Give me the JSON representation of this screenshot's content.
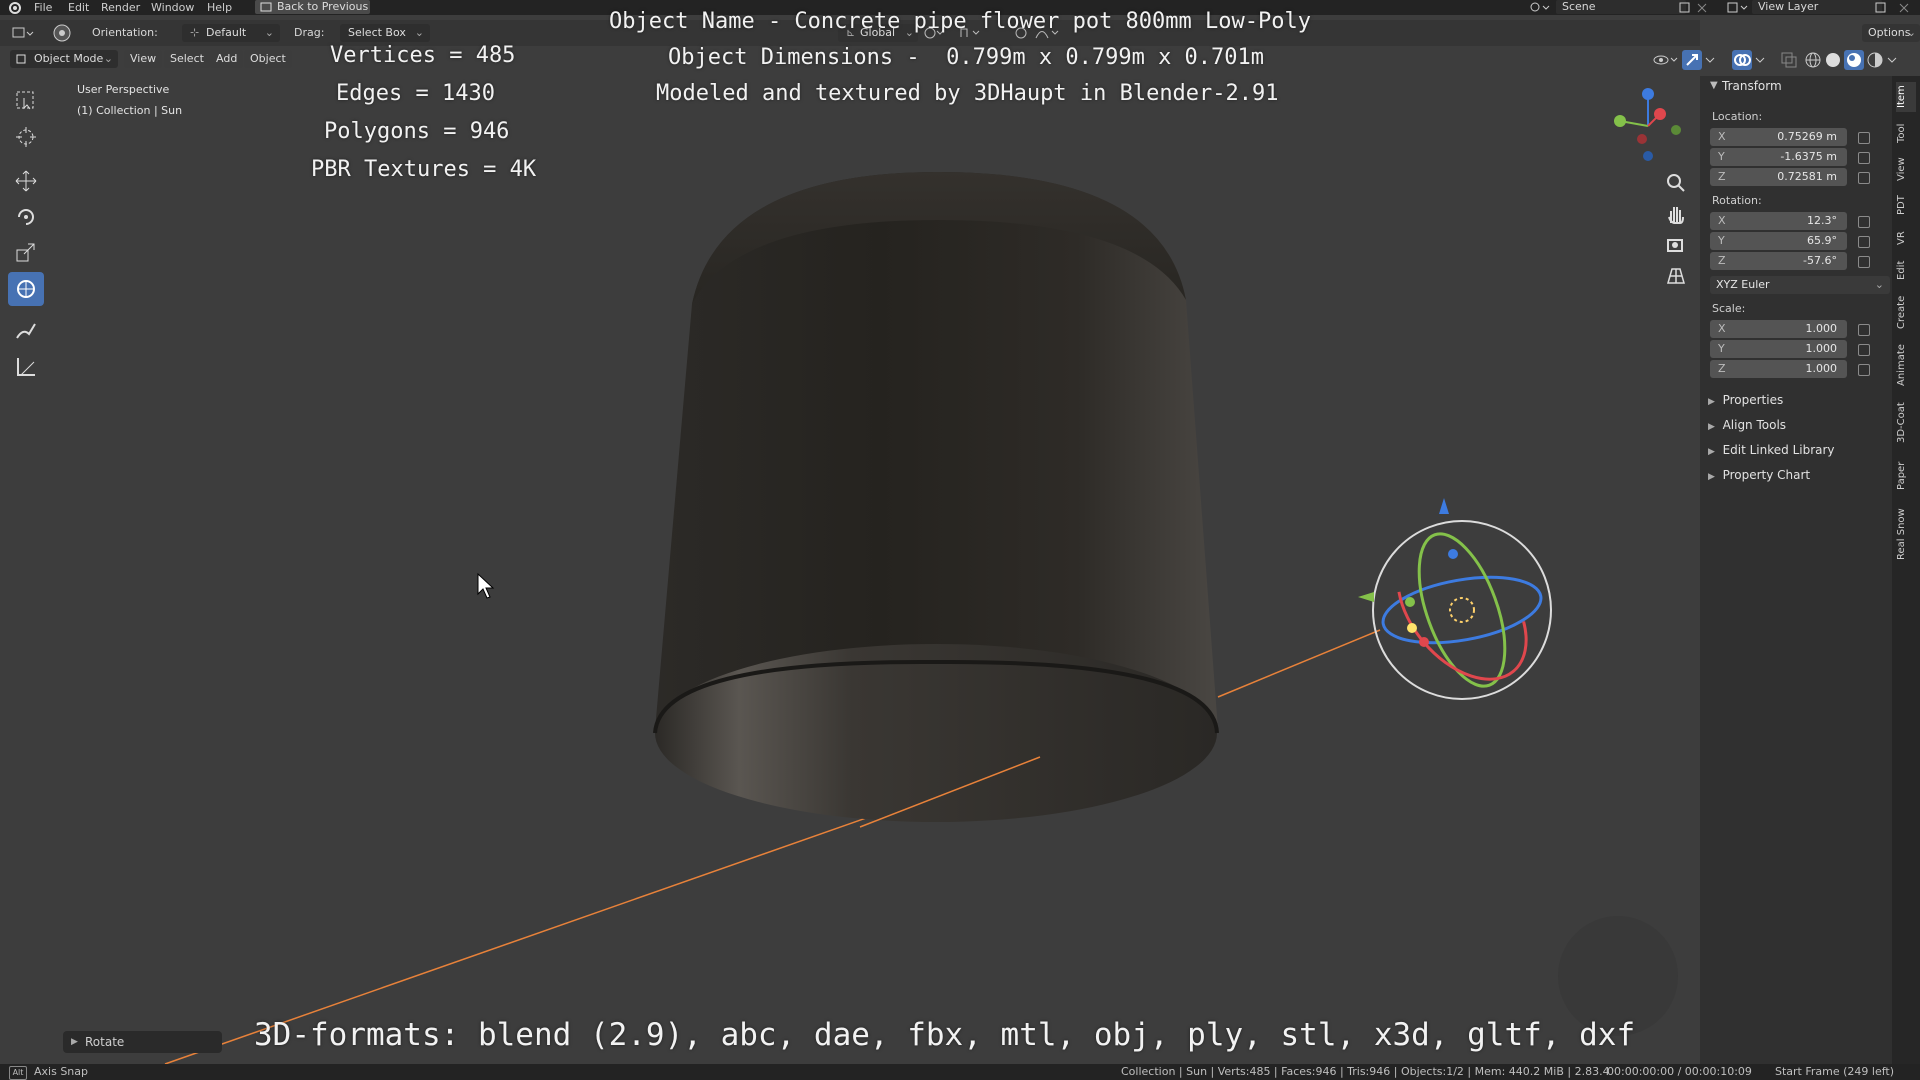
{
  "menu": {
    "items": [
      "File",
      "Edit",
      "Render",
      "Window",
      "Help"
    ],
    "back_button": "Back to Previous",
    "scene": "Scene",
    "view_layer": "View Layer"
  },
  "header": {
    "orientation_label": "Orientation:",
    "orientation_value": "Default",
    "drag_label": "Drag:",
    "drag_value": "Select Box",
    "transform_orientation": "Global",
    "options": "Options",
    "mode": "Object Mode",
    "view": "View",
    "select": "Select",
    "add": "Add",
    "object": "Object"
  },
  "viewport": {
    "perspective": "User Perspective",
    "collection": "(1) Collection | Sun"
  },
  "overlay": {
    "vertices": "Vertices = 485",
    "edges": "Edges = 1430",
    "polygons": "Polygons = 946",
    "pbr": "PBR Textures = 4K",
    "name": "Object Name - Concrete pipe flower pot 800mm Low-Poly",
    "dimensions": "Object Dimensions -  0.799m x 0.799m x 0.701m",
    "credit": "Modeled and textured by 3DHaupt in Blender-2.91",
    "formats": "3D-formats: blend (2.9), abc, dae, fbx, mtl, obj, ply, stl, x3d, gltf, dxf"
  },
  "npanel": {
    "transform": "Transform",
    "location_label": "Location:",
    "location": [
      {
        "axis": "X",
        "value": "0.75269 m"
      },
      {
        "axis": "Y",
        "value": "-1.6375 m"
      },
      {
        "axis": "Z",
        "value": "0.72581 m"
      }
    ],
    "rotation_label": "Rotation:",
    "rotation": [
      {
        "axis": "X",
        "value": "12.3°"
      },
      {
        "axis": "Y",
        "value": "65.9°"
      },
      {
        "axis": "Z",
        "value": "-57.6°"
      }
    ],
    "rotation_mode": "XYZ Euler",
    "scale_label": "Scale:",
    "scale": [
      {
        "axis": "X",
        "value": "1.000"
      },
      {
        "axis": "Y",
        "value": "1.000"
      },
      {
        "axis": "Z",
        "value": "1.000"
      }
    ],
    "sections": [
      "Properties",
      "Align Tools",
      "Edit Linked Library",
      "Property Chart"
    ],
    "tabs": [
      "Item",
      "Tool",
      "View",
      "PDT",
      "VR",
      "Edit",
      "Create",
      "Animate",
      "3D-Coat",
      "Paper",
      "Real Snow"
    ]
  },
  "rotate_panel": "Rotate",
  "status": {
    "left": "Axis Snap",
    "stats": "Collection | Sun | Verts:485 | Faces:946 | Tris:946 | Objects:1/2 | Mem: 440.2 MiB | 2.83.4",
    "time": "00:00:00:00 / 00:00:10:09",
    "frame": "Start Frame (249 left)"
  },
  "colors": {
    "bg": "#3d3d3d",
    "panel": "#303030",
    "accent": "#4772b3",
    "light_line": "#e8823a"
  }
}
